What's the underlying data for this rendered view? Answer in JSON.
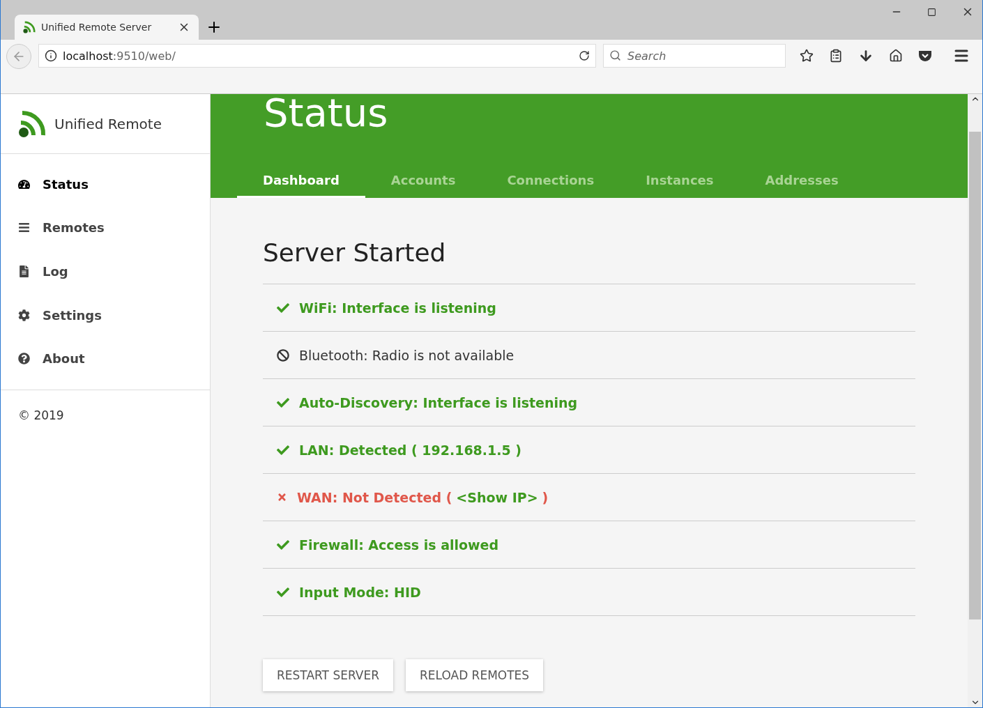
{
  "browser": {
    "tab_title": "Unified Remote Server",
    "url_host": "localhost",
    "url_rest": ":9510/web/",
    "search_placeholder": "Search"
  },
  "sidebar": {
    "brand": "Unified Remote",
    "items": [
      {
        "label": "Status",
        "selected": true
      },
      {
        "label": "Remotes",
        "selected": false
      },
      {
        "label": "Log",
        "selected": false
      },
      {
        "label": "Settings",
        "selected": false
      },
      {
        "label": "About",
        "selected": false
      }
    ],
    "footer": "© 2019"
  },
  "header": {
    "title": "Status",
    "tabs": [
      {
        "label": "Dashboard",
        "selected": true
      },
      {
        "label": "Accounts",
        "selected": false
      },
      {
        "label": "Connections",
        "selected": false
      },
      {
        "label": "Instances",
        "selected": false
      },
      {
        "label": "Addresses",
        "selected": false
      }
    ]
  },
  "content": {
    "heading": "Server Started",
    "statuses": [
      {
        "kind": "ok",
        "text": "WiFi: Interface is listening"
      },
      {
        "kind": "off",
        "text": "Bluetooth: Radio is not available"
      },
      {
        "kind": "ok",
        "text": "Auto-Discovery: Interface is listening"
      },
      {
        "kind": "ok",
        "text": "LAN: Detected ( 192.168.1.5 )"
      },
      {
        "kind": "error",
        "text": "WAN: Not Detected (",
        "link": "<Show IP>",
        "suffix": ")"
      },
      {
        "kind": "ok",
        "text": "Firewall: Access is allowed"
      },
      {
        "kind": "ok",
        "text": "Input Mode: HID"
      }
    ],
    "buttons": [
      "RESTART SERVER",
      "RELOAD REMOTES"
    ]
  }
}
